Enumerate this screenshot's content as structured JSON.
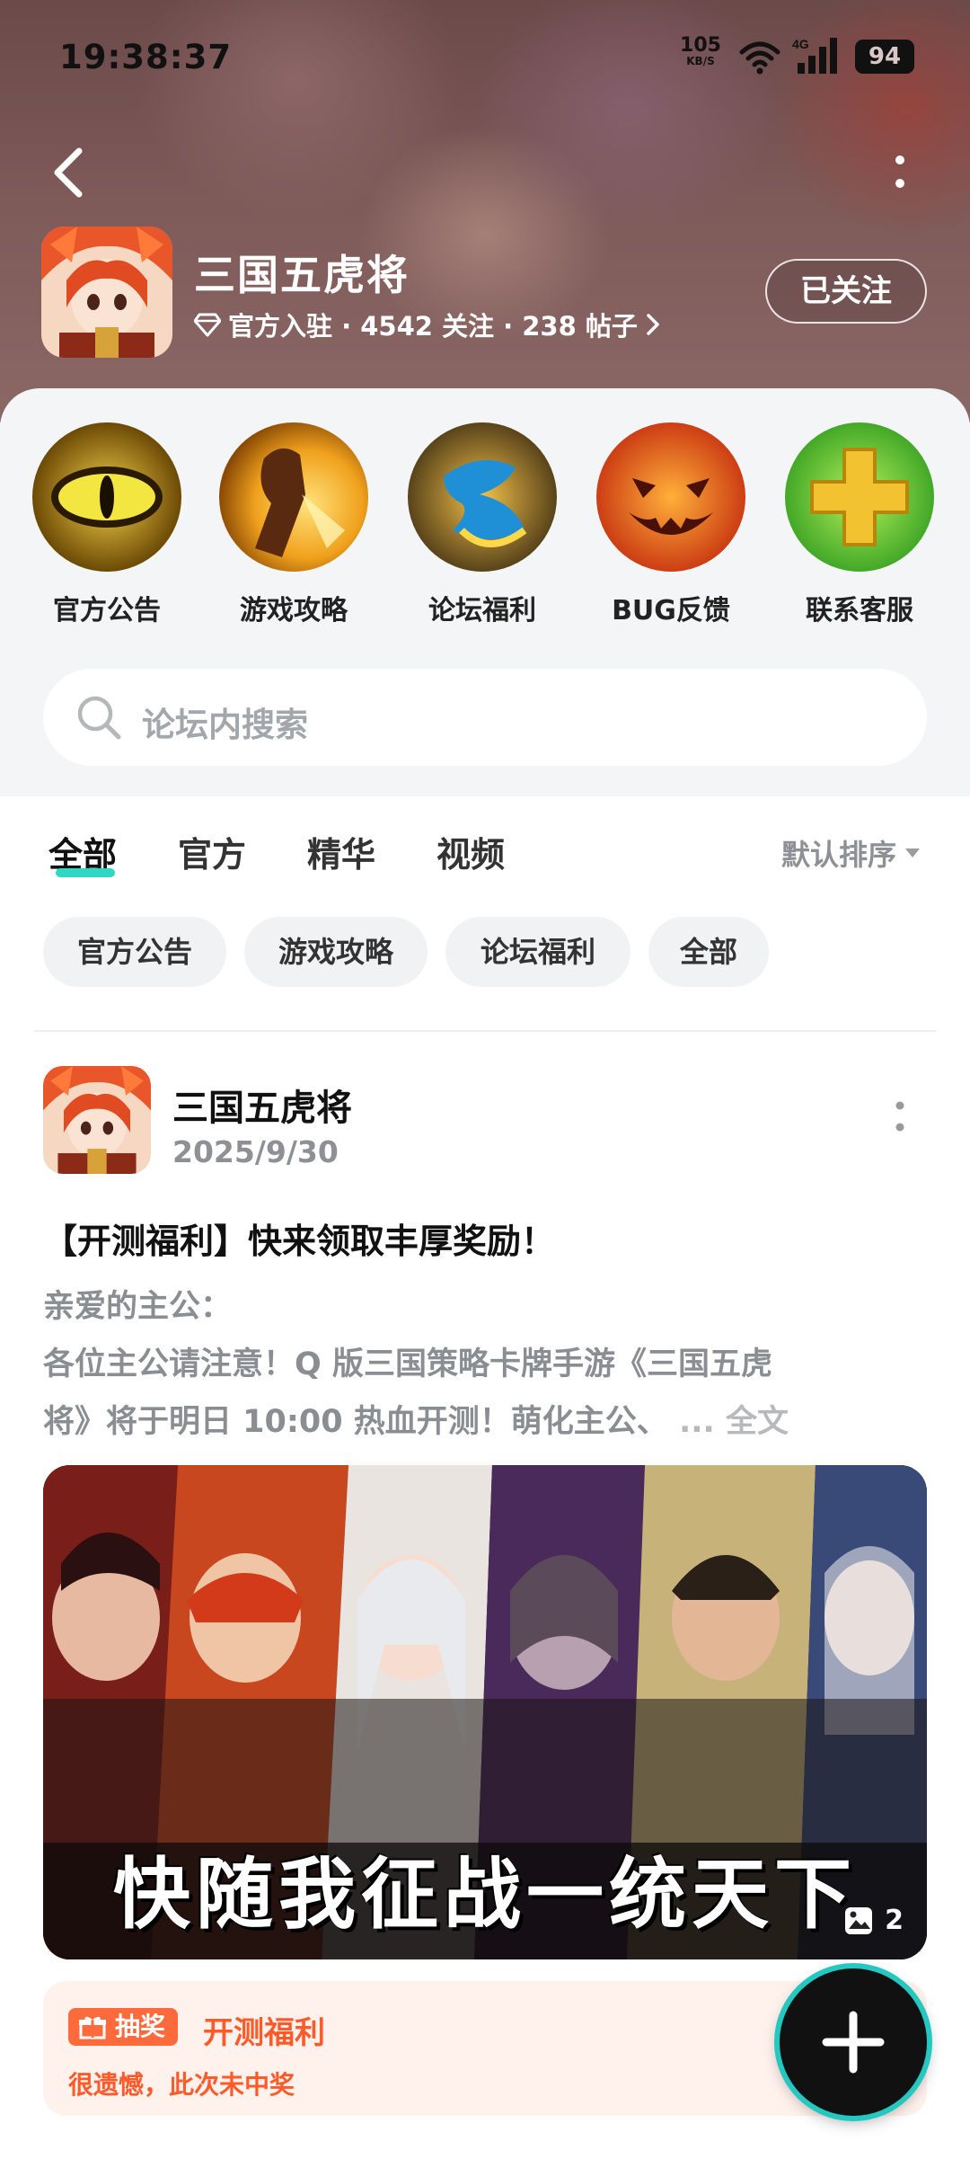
{
  "status_bar": {
    "time": "19:38:37",
    "net_speed_value": "105",
    "net_speed_unit": "KB/S",
    "network_type": "4G",
    "battery": "94"
  },
  "forum": {
    "name": "三国五虎将",
    "meta": "官方入驻 · 4542 关注 · 238 帖子",
    "follow_label": "已关注"
  },
  "shortcuts": [
    {
      "label": "官方公告",
      "icon": "eye-icon"
    },
    {
      "label": "游戏攻略",
      "icon": "fist-icon"
    },
    {
      "label": "论坛福利",
      "icon": "gift-icon"
    },
    {
      "label": "BUG反馈",
      "icon": "pumpkin-icon"
    },
    {
      "label": "联系客服",
      "icon": "plus-icon"
    }
  ],
  "search": {
    "placeholder": "论坛内搜索"
  },
  "tabs": [
    "全部",
    "官方",
    "精华",
    "视频"
  ],
  "sort_label": "默认排序",
  "filters": [
    "官方公告",
    "游戏攻略",
    "论坛福利",
    "全部"
  ],
  "post": {
    "author": "三国五虎将",
    "date": "2025/9/30",
    "title": "【开测福利】快来领取丰厚奖励！",
    "line1": "亲爱的主公：",
    "line2": " 各位主公请注意！Q 版三国策略卡牌手游《三国五虎",
    "line3": "将》将于明日 10:00 热血开测！萌化主公、",
    "ellipsis": "...",
    "full_text": "全文",
    "banner_text": "快随我征战一统天下",
    "image_count": "2"
  },
  "lottery": {
    "badge": "抽奖",
    "title": "开测福利",
    "result": "很遗憾，此次未中奖"
  },
  "colors": {
    "accent": "#2fd7c4",
    "lottery": "#ff5a2a"
  }
}
